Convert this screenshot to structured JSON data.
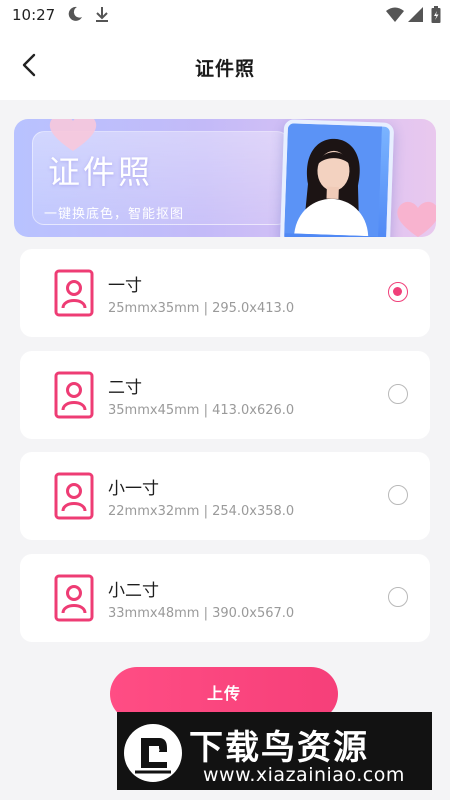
{
  "status_bar": {
    "time": "10:27"
  },
  "header": {
    "title": "证件照"
  },
  "banner": {
    "title": "证件照",
    "subtitle": "一键换底色，智能抠图"
  },
  "options": [
    {
      "name": "一寸",
      "spec": "25mmx35mm | 295.0x413.0",
      "selected": true
    },
    {
      "name": "二寸",
      "spec": "35mmx45mm | 413.0x626.0",
      "selected": false
    },
    {
      "name": "小一寸",
      "spec": "22mmx32mm | 254.0x358.0",
      "selected": false
    },
    {
      "name": "小二寸",
      "spec": "33mmx48mm | 390.0x567.0",
      "selected": false
    }
  ],
  "upload_label": "上传",
  "watermark": {
    "text": "下载鸟资源",
    "url": "www.xiazainiao.com"
  },
  "colors": {
    "accent": "#f0407a"
  }
}
